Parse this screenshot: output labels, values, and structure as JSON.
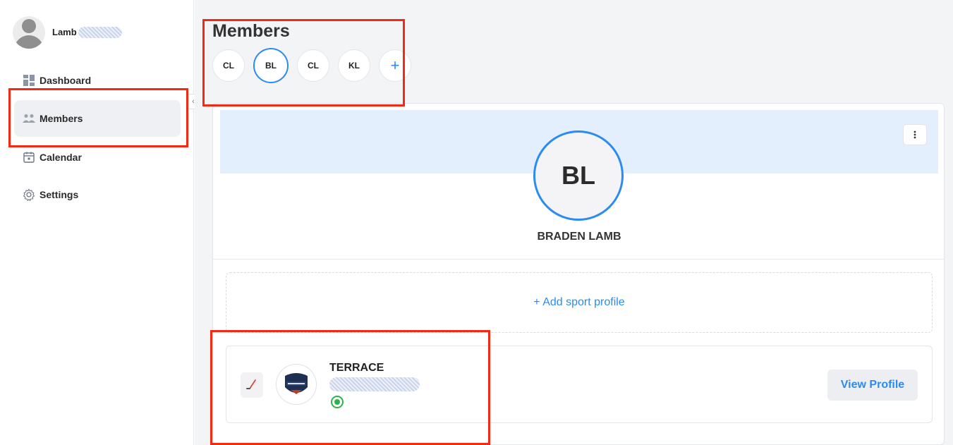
{
  "sidebar": {
    "user_name": "Lamb",
    "nav": [
      {
        "label": "Dashboard",
        "icon": "dashboard-icon"
      },
      {
        "label": "Members",
        "icon": "members-icon",
        "active": true
      },
      {
        "label": "Calendar",
        "icon": "calendar-icon"
      },
      {
        "label": "Settings",
        "icon": "settings-icon"
      }
    ],
    "collapse_glyph": "‹"
  },
  "main": {
    "title": "Members",
    "chips": [
      "CL",
      "BL",
      "CL",
      "KL"
    ],
    "selected_chip_index": 1,
    "add_chip_glyph": "+",
    "profile": {
      "initials": "BL",
      "name": "BRADEN LAMB",
      "menu_glyph": "⋮"
    },
    "add_sport_label": "+ Add sport profile",
    "team": {
      "name": "TERRACE",
      "view_profile_label": "View Profile"
    }
  },
  "colors": {
    "accent": "#2a8bf2",
    "annotation": "#f22a14",
    "banner": "#e3effc",
    "status_green": "#2fb24c"
  }
}
